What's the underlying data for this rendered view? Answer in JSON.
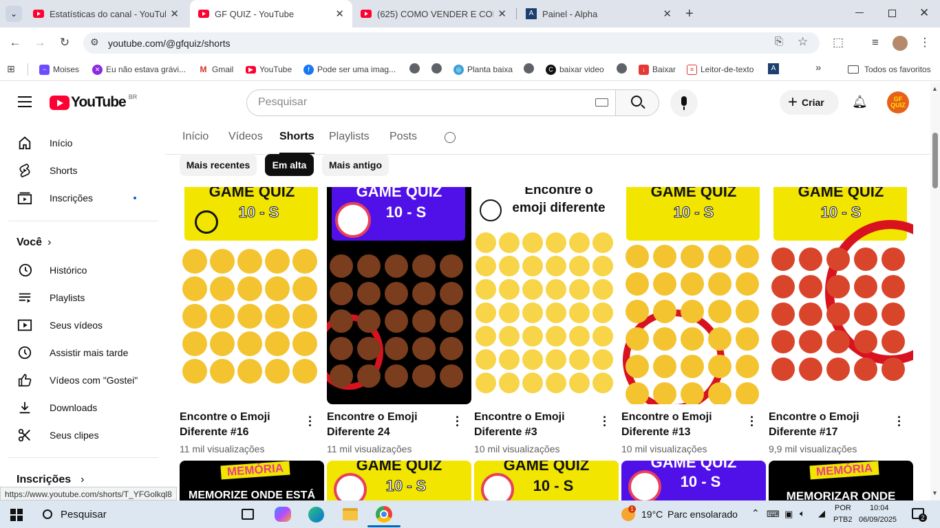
{
  "browser": {
    "tabs": [
      {
        "title": "Estatísticas do canal - YouTube"
      },
      {
        "title": "GF QUIZ - YouTube"
      },
      {
        "title": "(625) COMO VENDER E COMPR"
      },
      {
        "title": "Painel - Alpha"
      }
    ],
    "url": "youtube.com/@gfquiz/shorts",
    "bookmarks": [
      {
        "label": "Moises",
        "icon": "moises-icon"
      },
      {
        "label": "Eu não estava grávi...",
        "icon": "purple-circle-icon"
      },
      {
        "label": "Gmail",
        "icon": "gmail-icon"
      },
      {
        "label": "YouTube",
        "icon": "youtube-icon"
      },
      {
        "label": "Pode ser uma imag...",
        "icon": "facebook-icon"
      },
      {
        "label": "Planta baixa",
        "icon": "planta-icon"
      },
      {
        "label": "baixar video",
        "icon": "baixar-video-icon"
      },
      {
        "label": "Baixar",
        "icon": "download-bookmark-icon"
      },
      {
        "label": "Leitor-de-texto",
        "icon": "reader-icon"
      }
    ],
    "all_bookmarks": "Todos os favoritos",
    "status_url": "https://www.youtube.com/shorts/T_YFGolkql8"
  },
  "youtube": {
    "logo_text": "YouTube",
    "region": "BR",
    "search_placeholder": "Pesquisar",
    "create_label": "Criar",
    "avatar_text": "GF QUIZ",
    "sidebar": {
      "main": [
        {
          "label": "Início",
          "icon": "home-icon"
        },
        {
          "label": "Shorts",
          "icon": "shorts-icon"
        },
        {
          "label": "Inscrições",
          "icon": "subscriptions-icon"
        }
      ],
      "you_heading": "Você",
      "you": [
        {
          "label": "Histórico",
          "icon": "history-icon"
        },
        {
          "label": "Playlists",
          "icon": "playlists-icon"
        },
        {
          "label": "Seus vídeos",
          "icon": "your-videos-icon"
        },
        {
          "label": "Assistir mais tarde",
          "icon": "watch-later-icon"
        },
        {
          "label": "Vídeos com \"Gostei\"",
          "icon": "like-icon"
        },
        {
          "label": "Downloads",
          "icon": "download-icon"
        },
        {
          "label": "Seus clipes",
          "icon": "scissors-icon"
        }
      ],
      "subs_heading": "Inscrições"
    },
    "channel_tabs": [
      "Início",
      "Vídeos",
      "Shorts",
      "Playlists",
      "Posts"
    ],
    "active_tab": "Shorts",
    "chips": [
      "Mais recentes",
      "Em alta",
      "Mais antigo"
    ],
    "selected_chip": "Em alta",
    "shorts": [
      {
        "title": "Encontre o Emoji Diferente #16",
        "views": "11 mil visualizações",
        "thumb_top": "GAME QUIZ",
        "thumb_timer": "10 - S"
      },
      {
        "title": "Encontre o Emoji Diferente 24",
        "views": "11 mil visualizações",
        "thumb_top": "GAME QUIZ",
        "thumb_timer": "10 - S"
      },
      {
        "title": "Encontre o Emoji Diferente #3",
        "views": "10 mil visualizações",
        "thumb_top": "Encontre o emoji diferente"
      },
      {
        "title": "Encontre o Emoji Diferente #13",
        "views": "10 mil visualizações",
        "thumb_top": "GAME QUIZ",
        "thumb_timer": "10 - S"
      },
      {
        "title": "Encontre o Emoji Diferente #17",
        "views": "9,9 mil visualizações",
        "thumb_top": "GAME QUIZ",
        "thumb_timer": "10 - S"
      }
    ],
    "row2": [
      {
        "top": "MEMÓRIA",
        "sub": "MEMORIZE ONDE ESTÁ"
      },
      {
        "top": "GAME QUIZ",
        "sub": "10 - S"
      },
      {
        "top": "GAME QUIZ",
        "sub": "10 - S"
      },
      {
        "top": "GAME QUIZ",
        "sub": "10 - S"
      },
      {
        "top": "MEMÓRIA",
        "sub": "MEMORIZAR ONDE"
      }
    ]
  },
  "taskbar": {
    "search_placeholder": "Pesquisar",
    "weather_temp": "19°C",
    "weather_text": "Parc ensolarado",
    "weather_badge": "1",
    "lang": "POR",
    "lang2": "PTB2",
    "time": "10:04",
    "date": "06/09/2025",
    "notif_count": "2"
  }
}
